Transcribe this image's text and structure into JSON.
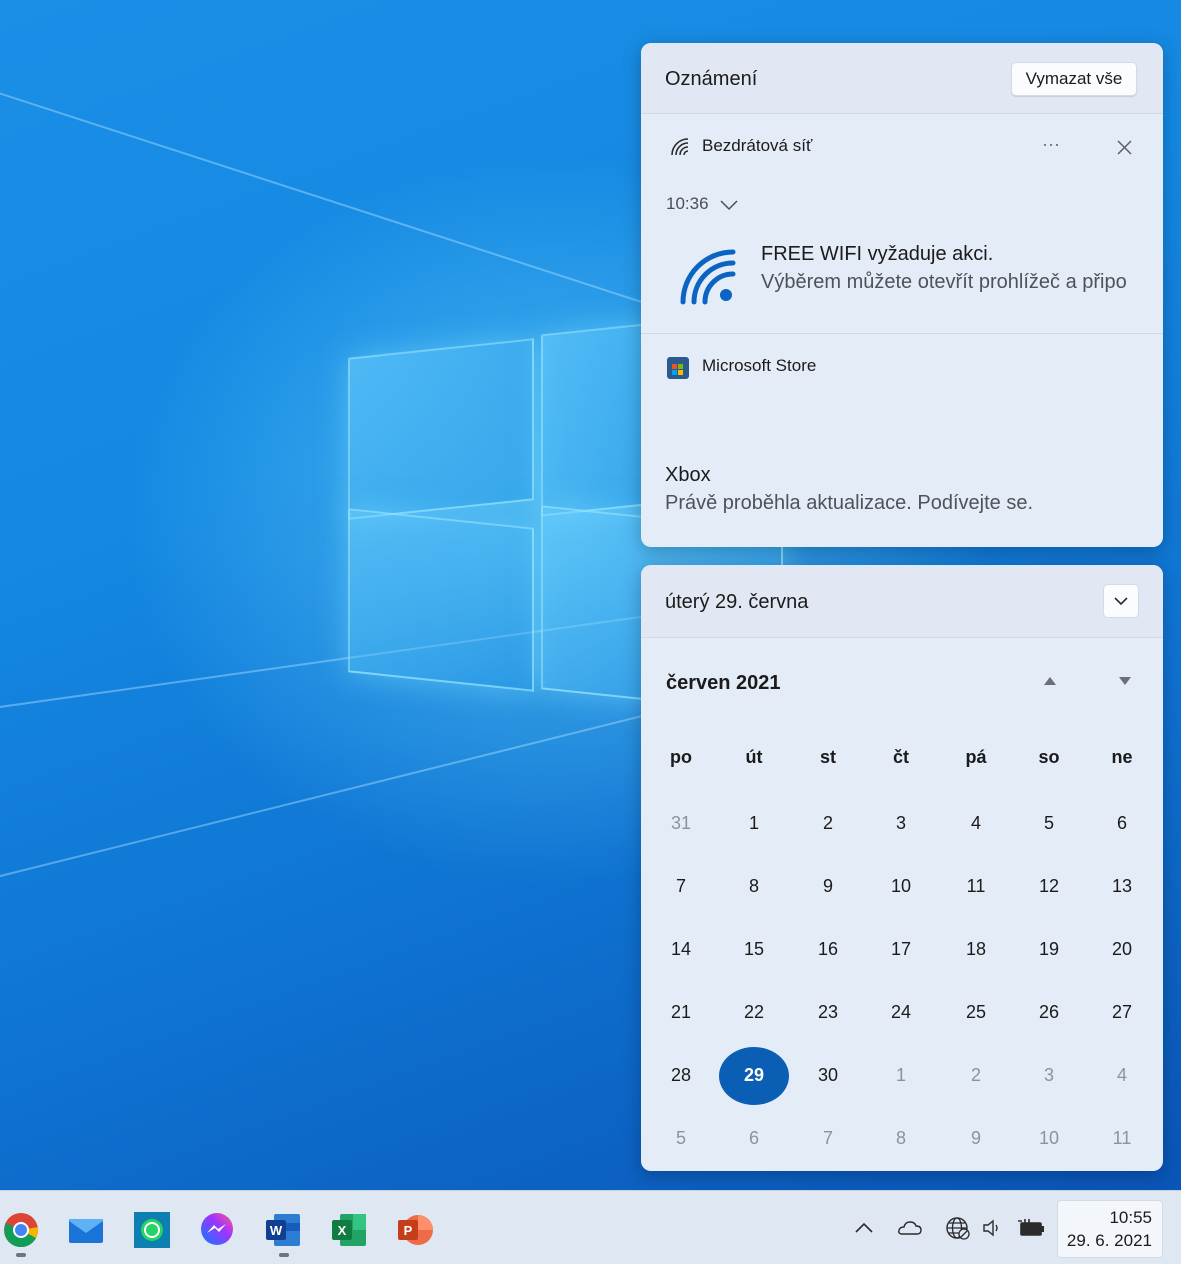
{
  "notifications": {
    "title": "Oznámení",
    "clear_all": "Vymazat vše",
    "wifi": {
      "app_name": "Bezdrátová síť",
      "more": "···",
      "time": "10:36",
      "heading": "FREE WIFI vyžaduje akci.",
      "body": "Výběrem můžete otevřít prohlížeč a připo"
    },
    "store": {
      "app_name": "Microsoft Store",
      "heading": "Xbox",
      "body": "Právě proběhla aktualizace. Podívejte se."
    }
  },
  "calendar": {
    "date_header": "úterý 29. června",
    "month_label": "červen 2021",
    "weekdays": [
      "po",
      "út",
      "st",
      "čt",
      "pá",
      "so",
      "ne"
    ],
    "weeks": [
      [
        {
          "d": "31",
          "o": true
        },
        {
          "d": "1"
        },
        {
          "d": "2"
        },
        {
          "d": "3"
        },
        {
          "d": "4"
        },
        {
          "d": "5"
        },
        {
          "d": "6"
        }
      ],
      [
        {
          "d": "7"
        },
        {
          "d": "8"
        },
        {
          "d": "9"
        },
        {
          "d": "10"
        },
        {
          "d": "11"
        },
        {
          "d": "12"
        },
        {
          "d": "13"
        }
      ],
      [
        {
          "d": "14"
        },
        {
          "d": "15"
        },
        {
          "d": "16"
        },
        {
          "d": "17"
        },
        {
          "d": "18"
        },
        {
          "d": "19"
        },
        {
          "d": "20"
        }
      ],
      [
        {
          "d": "21"
        },
        {
          "d": "22"
        },
        {
          "d": "23"
        },
        {
          "d": "24"
        },
        {
          "d": "25"
        },
        {
          "d": "26"
        },
        {
          "d": "27"
        }
      ],
      [
        {
          "d": "28"
        },
        {
          "d": "29",
          "today": true
        },
        {
          "d": "30"
        },
        {
          "d": "1",
          "o": true
        },
        {
          "d": "2",
          "o": true
        },
        {
          "d": "3",
          "o": true
        },
        {
          "d": "4",
          "o": true
        }
      ],
      [
        {
          "d": "5",
          "o": true
        },
        {
          "d": "6",
          "o": true
        },
        {
          "d": "7",
          "o": true
        },
        {
          "d": "8",
          "o": true
        },
        {
          "d": "9",
          "o": true
        },
        {
          "d": "10",
          "o": true
        },
        {
          "d": "11",
          "o": true
        }
      ]
    ],
    "accent": "#0a5fb4"
  },
  "taskbar": {
    "apps": [
      {
        "name": "chrome-icon",
        "running": true
      },
      {
        "name": "mail-icon",
        "running": false
      },
      {
        "name": "whatsapp-icon",
        "running": false
      },
      {
        "name": "messenger-icon",
        "running": false
      },
      {
        "name": "word-icon",
        "running": true
      },
      {
        "name": "excel-icon",
        "running": false
      },
      {
        "name": "powerpoint-icon",
        "running": false
      }
    ],
    "clock_time": "10:55",
    "clock_date": "29. 6. 2021"
  }
}
